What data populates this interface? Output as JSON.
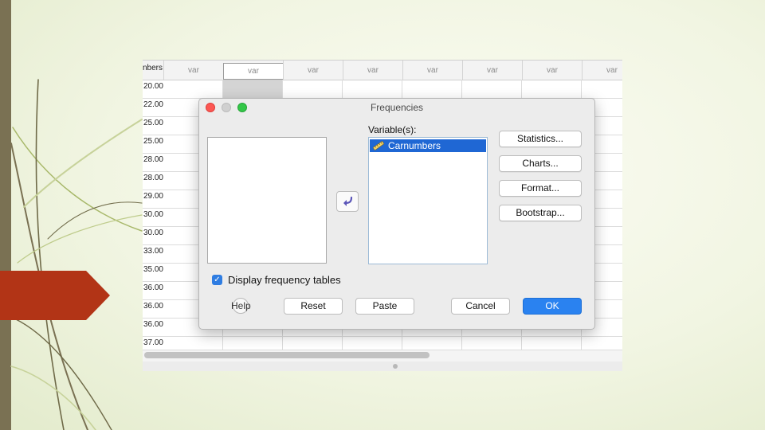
{
  "colors": {
    "slide_bar": "#7a7153",
    "slide_tab": "#b23416",
    "selection_blue": "#1f67d4",
    "ok_button": "#2a82f0"
  },
  "sheet": {
    "first_header": "nbers",
    "column_headers": [
      "var",
      "var",
      "var",
      "var",
      "var",
      "var",
      "var",
      "var"
    ],
    "row_values": [
      "20.00",
      "22.00",
      "25.00",
      "25.00",
      "28.00",
      "28.00",
      "29.00",
      "30.00",
      "30.00",
      "33.00",
      "35.00",
      "36.00",
      "36.00",
      "36.00",
      "37.00"
    ]
  },
  "dialog": {
    "title": "Frequencies",
    "variables_label": "Variable(s):",
    "selected_variable": "Carnumbers",
    "variable_icon": "ruler-scale-icon",
    "move_icon": "curved-arrow-left-icon",
    "side_buttons": [
      "Statistics...",
      "Charts...",
      "Format...",
      "Bootstrap..."
    ],
    "display_tables_label": "Display frequency tables",
    "display_tables_checked": true,
    "help_label": "Help",
    "help_icon": "question-mark-icon",
    "reset_label": "Reset",
    "paste_label": "Paste",
    "cancel_label": "Cancel",
    "ok_label": "OK"
  }
}
